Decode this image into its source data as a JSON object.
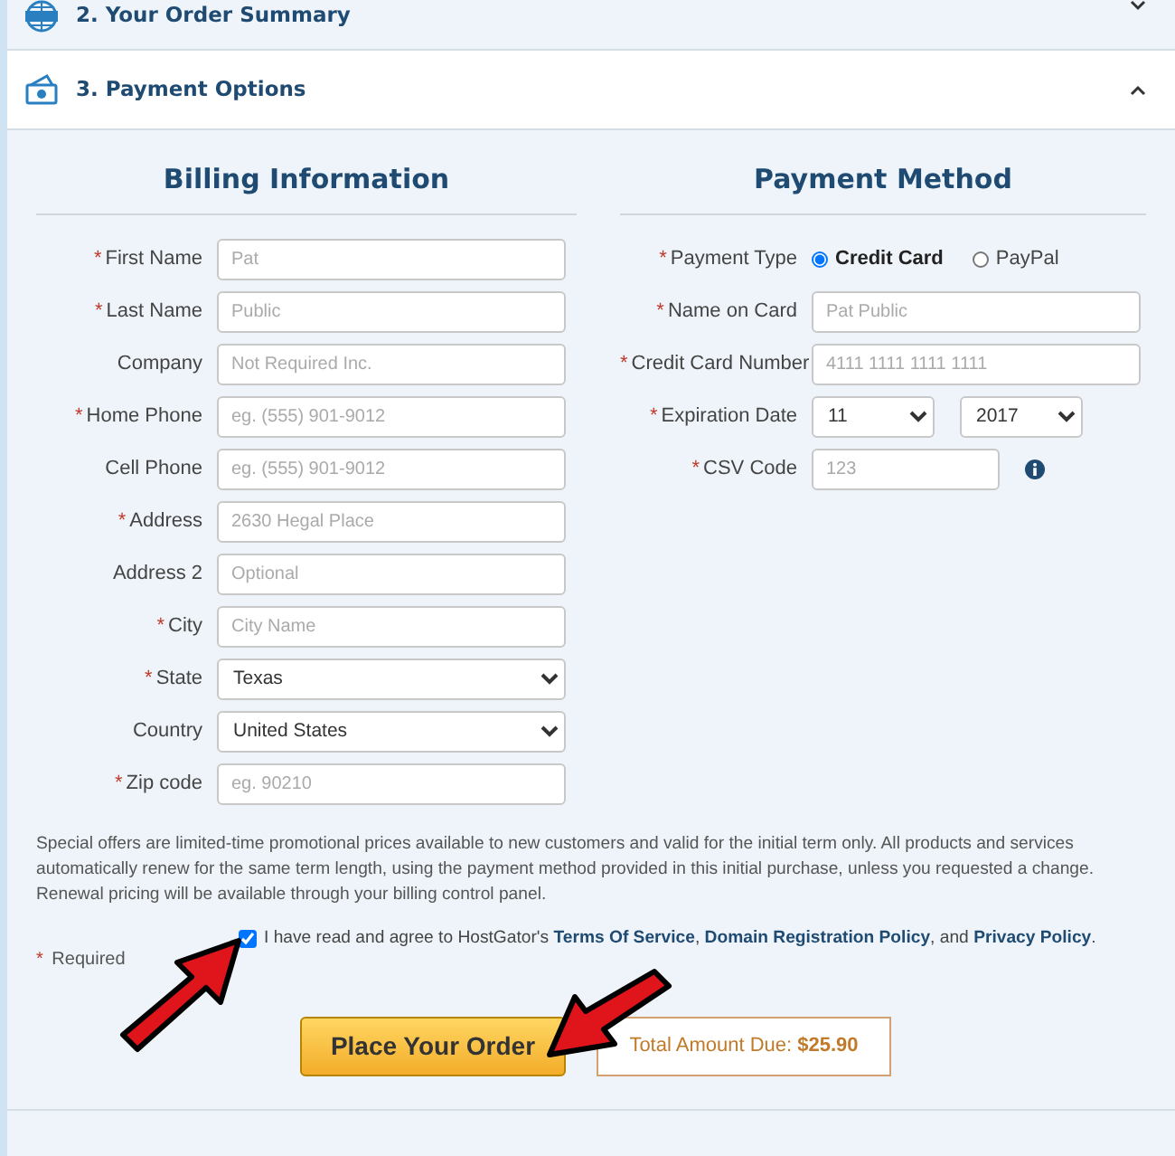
{
  "sections": [
    {
      "number": "2.",
      "title": "Your Order Summary",
      "expanded": false
    },
    {
      "number": "3.",
      "title": "Payment Options",
      "expanded": true
    }
  ],
  "required_mark": "*",
  "billing": {
    "heading": "Billing Information",
    "fields": [
      {
        "kind": "text",
        "label": "First Name",
        "required": true,
        "placeholder": "Pat"
      },
      {
        "kind": "text",
        "label": "Last Name",
        "required": true,
        "placeholder": "Public"
      },
      {
        "kind": "text",
        "label": "Company",
        "required": false,
        "placeholder": "Not Required Inc."
      },
      {
        "kind": "text",
        "label": "Home Phone",
        "required": true,
        "placeholder": "eg. (555) 901-9012"
      },
      {
        "kind": "text",
        "label": "Cell Phone",
        "required": false,
        "placeholder": "eg. (555) 901-9012"
      },
      {
        "kind": "text",
        "label": "Address",
        "required": true,
        "placeholder": "2630 Hegal Place"
      },
      {
        "kind": "text",
        "label": "Address 2",
        "required": false,
        "placeholder": "Optional"
      },
      {
        "kind": "text",
        "label": "City",
        "required": true,
        "placeholder": "City Name"
      },
      {
        "kind": "select",
        "label": "State",
        "required": true,
        "value": "Texas"
      },
      {
        "kind": "select",
        "label": "Country",
        "required": false,
        "value": "United States"
      },
      {
        "kind": "text",
        "label": "Zip code",
        "required": true,
        "placeholder": "eg. 90210"
      }
    ]
  },
  "payment": {
    "heading": "Payment Method",
    "fields": [
      {
        "kind": "radio",
        "label": "Payment Type",
        "required": true,
        "options": [
          {
            "label": "Credit Card",
            "selected": true
          },
          {
            "label": "PayPal",
            "selected": false
          }
        ]
      },
      {
        "kind": "text",
        "label": "Name on Card",
        "required": true,
        "placeholder": "Pat Public"
      },
      {
        "kind": "text",
        "label": "Credit Card Number",
        "required": true,
        "placeholder": "4111 1111 1111 1111"
      },
      {
        "kind": "date",
        "label": "Expiration Date",
        "required": true,
        "month": "11",
        "year": "2017"
      },
      {
        "kind": "code",
        "label": "CSV Code",
        "required": true,
        "placeholder": "123"
      }
    ]
  },
  "disclaimer": "Special offers are limited-time promotional prices available to new customers and valid for the initial term only. All products and services automatically renew for the same term length, using the payment method provided in this initial purchase, unless you requested a change. Renewal pricing will be available through your billing control panel.",
  "agreement": {
    "checked": true,
    "text": "I have read and agree to HostGator's **Terms Of Service**, **Domain Registration Policy**, and **Privacy Policy**."
  },
  "required_note": "Required",
  "order_button": "Place Your Order",
  "total": {
    "label": "Total Amount Due:",
    "amount": "$25.90"
  }
}
